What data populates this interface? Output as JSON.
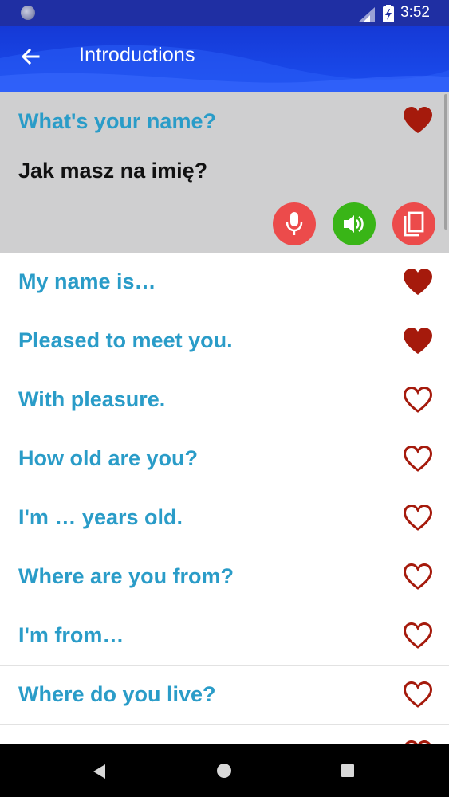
{
  "status_bar": {
    "time": "3:52",
    "icons": [
      "notification-circle-icon",
      "signal-icon",
      "battery-charging-icon"
    ]
  },
  "app_bar": {
    "title": "Introductions",
    "back_icon": "arrow-left-icon"
  },
  "expanded_phrase": {
    "phrase": "What's your name?",
    "translation": "Jak masz na imię?",
    "favorite": true,
    "actions": [
      "microphone-icon",
      "speaker-icon",
      "copy-icon"
    ]
  },
  "phrases": [
    {
      "label": "My name is…",
      "favorite": true
    },
    {
      "label": "Pleased to meet you.",
      "favorite": true
    },
    {
      "label": "With pleasure.",
      "favorite": false
    },
    {
      "label": "How old are you?",
      "favorite": false
    },
    {
      "label": "I'm … years old.",
      "favorite": false
    },
    {
      "label": "Where are you from?",
      "favorite": false
    },
    {
      "label": "I'm from…",
      "favorite": false
    },
    {
      "label": "Where do you live?",
      "favorite": false
    }
  ],
  "colors": {
    "status_bar": "#1f2fa3",
    "app_bar": "#1b4ef0",
    "phrase_text": "#2a9cc8",
    "heart": "#a51a0c",
    "mic_button": "#ec4b4b",
    "speaker_button": "#39b517",
    "copy_button": "#ec4b4b",
    "expanded_bg": "#cfcfd0"
  },
  "nav_bar": {
    "icons": [
      "nav-back-icon",
      "nav-home-icon",
      "nav-recents-icon"
    ]
  }
}
